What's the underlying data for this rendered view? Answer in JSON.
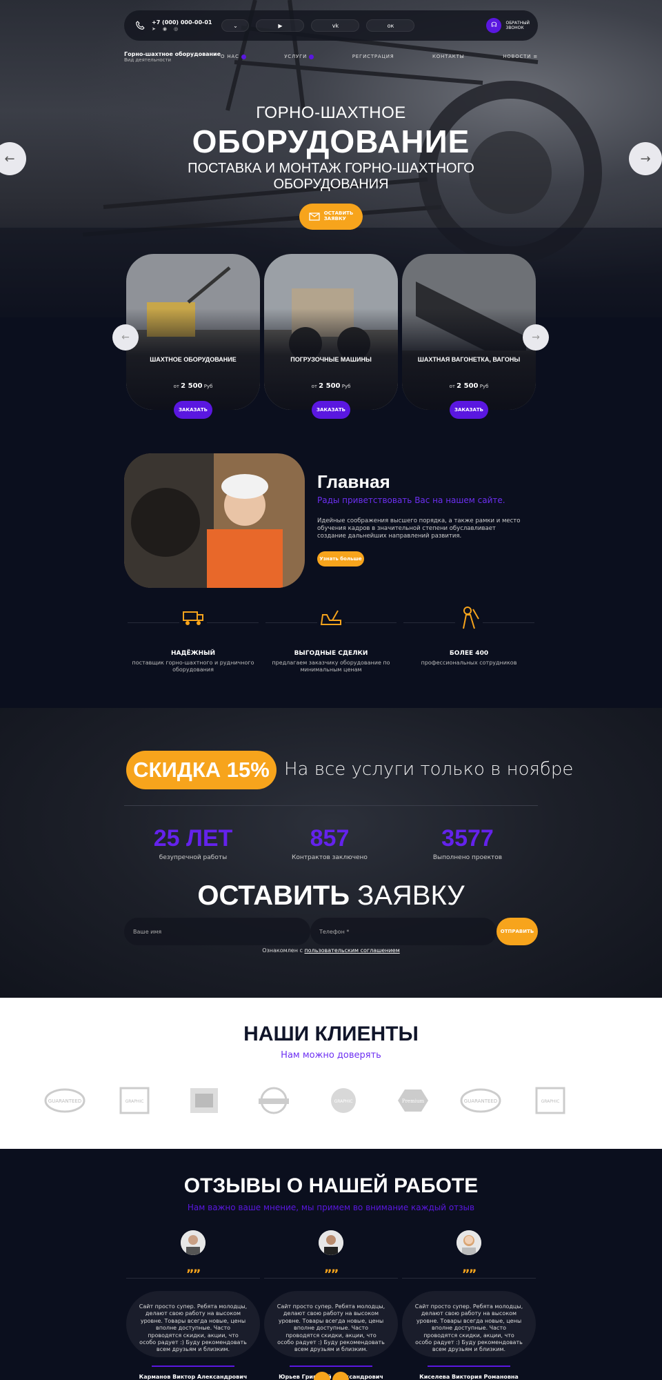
{
  "header": {
    "phone": "+7 (000) 000-00-01",
    "callback_line1": "ОБРАТНЫЙ",
    "callback_line2": "ЗВОНОК",
    "brand_title": "Горно-шахтное оборудование",
    "brand_subtitle": "Вид деятельности",
    "nav": [
      "О НАС",
      "УСЛУГИ",
      "РЕГИСТРАЦИЯ",
      "КОНТАКТЫ",
      "НОВОСТИ"
    ]
  },
  "hero": {
    "subtitle": "ГОРНО-ШАХТНОЕ",
    "title": "ОБОРУДОВАНИЕ",
    "desc_line1": "ПОСТАВКА И МОНТАЖ ГОРНО-ШАХТНОГО",
    "desc_line2": "ОБОРУДОВАНИЯ",
    "button_line1": "ОСТАВИТЬ",
    "button_line2": "ЗАЯВКУ"
  },
  "products": [
    {
      "name": "ШАХТНОЕ ОБОРУДОВАНИЕ",
      "price_prefix": "от",
      "price": "2 500",
      "currency": "Руб",
      "button": "ЗАКАЗАТЬ"
    },
    {
      "name": "ПОГРУЗОЧНЫЕ МАШИНЫ",
      "price_prefix": "от",
      "price": "2 500",
      "currency": "Руб",
      "button": "ЗАКАЗАТЬ"
    },
    {
      "name": "ШАХТНАЯ ВАГОНЕТКА, ВАГОНЫ",
      "price_prefix": "от",
      "price": "2 500",
      "currency": "Руб",
      "button": "ЗАКАЗАТЬ"
    }
  ],
  "about": {
    "title": "Главная",
    "subtitle": "Рады приветствовать Вас на нашем сайте.",
    "text": "Идейные соображения высшего порядка, а также рамки и место обучения кадров в значительной степени обуславливает создание дальнейших направлений развития.",
    "button": "Узнать больше"
  },
  "features": [
    {
      "icon": "truck-icon",
      "title": "НАДЁЖНЫЙ",
      "desc": "поставщик горно-шахтного и рудничного оборудования"
    },
    {
      "icon": "excavator-icon",
      "title": "ВЫГОДНЫЕ СДЕЛКИ",
      "desc": "предлагаем заказчику оборудование по минимальным ценам"
    },
    {
      "icon": "miner-icon",
      "title": "БОЛЕЕ 400",
      "desc": "профессиональных сотрудников"
    }
  ],
  "promo": {
    "discount": "СКИДКА 15%",
    "text": "На все услуги только в ноябре",
    "stats": [
      {
        "value": "25 ЛЕТ",
        "label": "безупречной работы"
      },
      {
        "value": "857",
        "label": "Контрактов заключено"
      },
      {
        "value": "3577",
        "label": "Выполнено проектов"
      }
    ]
  },
  "form": {
    "title_bold": "ОСТАВИТЬ",
    "title_light": "ЗАЯВКУ",
    "name_placeholder": "Ваше имя",
    "phone_placeholder": "Телефон *",
    "submit": "ОТПРАВИТЬ",
    "agree_prefix": "Ознакомлен с",
    "agree_link": "пользовательским соглашением"
  },
  "clients": {
    "title": "НАШИ КЛИЕНТЫ",
    "subtitle": "Нам можно доверять",
    "logos": [
      "GUARANTEED",
      "GRAPHIC",
      "",
      "",
      "GRAPHIC",
      "Premium",
      "GUARANTEED",
      "GRAPHIC"
    ]
  },
  "reviews": {
    "title": "ОТЗЫВЫ О НАШЕЙ РАБОТЕ",
    "subtitle": "Нам важно ваше мнение, мы примем во внимание каждый отзыв",
    "items": [
      {
        "text": "Сайт просто супер. Ребята молодцы, делают свою работу на высоком уровне. Товары всегда новые, цены вполне доступные. Часто проводятся скидки, акции, что особо радует :) Буду рекомендовать всем друзьям и близким.",
        "name": "Карманов Виктор Александрович"
      },
      {
        "text": "Сайт просто супер. Ребята молодцы, делают свою работу на высоком уровне. Товары всегда новые, цены вполне доступные. Часто проводятся скидки, акции, что особо радует :) Буду рекомендовать всем друзьям и близким.",
        "name": "Юрьев Григорий Александрович"
      },
      {
        "text": "Сайт просто супер. Ребята молодцы, делают свою работу на высоком уровне. Товары всегда новые, цены вполне доступные. Часто проводятся скидки, акции, что особо радует :) Буду рекомендовать всем друзьям и близким.",
        "name": "Киселева Виктория Романовна"
      }
    ]
  },
  "colors": {
    "accent": "#f7a41c",
    "purple": "#5a17e0",
    "dark": "#0b0f1e"
  }
}
